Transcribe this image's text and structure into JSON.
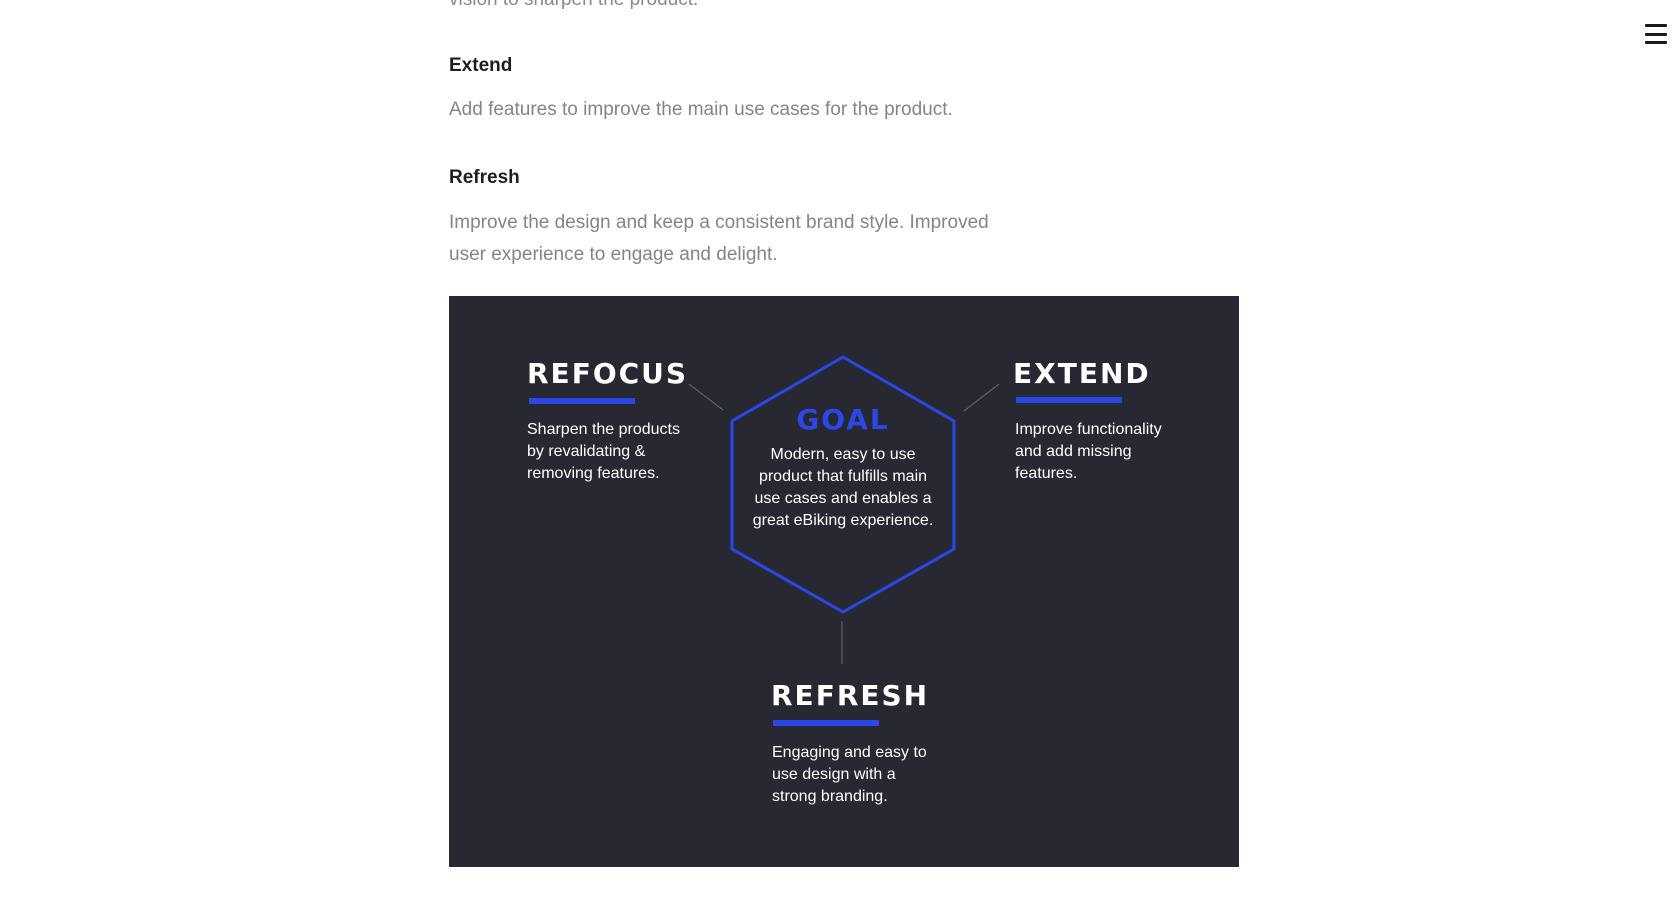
{
  "article": {
    "cut_line": "vision to sharpen the product.",
    "extend_heading": "Extend",
    "extend_text": "Add features to improve the main use cases for the product.",
    "refresh_heading": "Refresh",
    "refresh_text": "Improve the design and keep a consistent brand style. Improved user experience to engage and delight."
  },
  "diagram": {
    "refocus": {
      "title": "REFOCUS",
      "text": "Sharpen the products\nby revalidating &\nremoving features."
    },
    "extend": {
      "title": "EXTEND",
      "text": "Improve functionality\nand add missing\nfeatures."
    },
    "goal": {
      "title": "GOAL",
      "text": "Modern, easy to use\nproduct that fulfills main\nuse cases and enables a\ngreat eBiking experience."
    },
    "refresh": {
      "title": "REFRESH",
      "text": "Engaging and easy to\nuse design with a\nstrong branding."
    },
    "colors": {
      "background": "#272831",
      "accent": "#2b47e6",
      "text": "#ffffff"
    }
  },
  "nav": {
    "menu_icon": "hamburger-menu-icon"
  }
}
